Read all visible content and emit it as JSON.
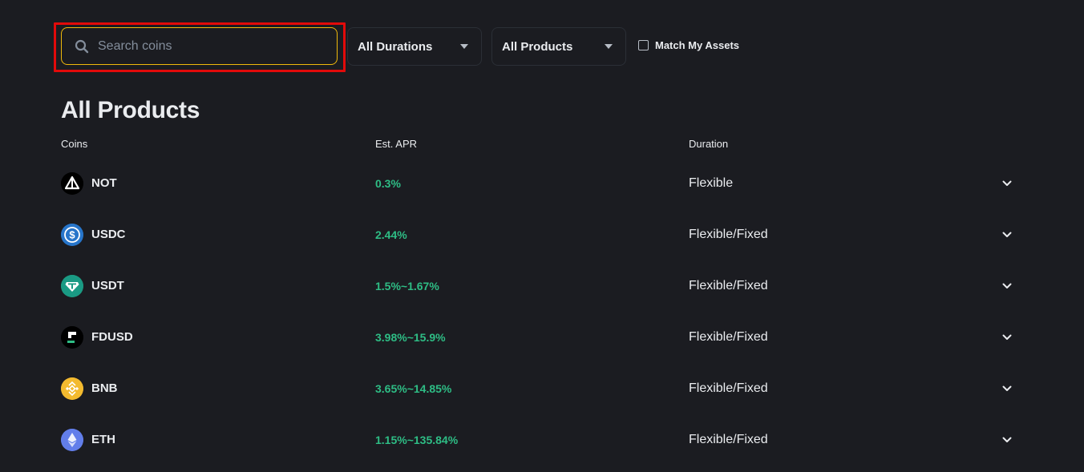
{
  "filters": {
    "search_placeholder": "Search coins",
    "search_value": "",
    "durations_label": "All Durations",
    "products_label": "All Products",
    "match_assets_label": "Match My Assets",
    "match_assets_checked": false
  },
  "title": "All Products",
  "columns": {
    "coins": "Coins",
    "apr": "Est. APR",
    "duration": "Duration"
  },
  "rows": [
    {
      "coin": "NOT",
      "apr": "0.3%",
      "duration": "Flexible",
      "icon": "notcoin-icon"
    },
    {
      "coin": "USDC",
      "apr": "2.44%",
      "duration": "Flexible/Fixed",
      "icon": "usdc-icon"
    },
    {
      "coin": "USDT",
      "apr": "1.5%~1.67%",
      "duration": "Flexible/Fixed",
      "icon": "usdt-icon"
    },
    {
      "coin": "FDUSD",
      "apr": "3.98%~15.9%",
      "duration": "Flexible/Fixed",
      "icon": "fdusd-icon"
    },
    {
      "coin": "BNB",
      "apr": "3.65%~14.85%",
      "duration": "Flexible/Fixed",
      "icon": "bnb-icon"
    },
    {
      "coin": "ETH",
      "apr": "1.15%~135.84%",
      "duration": "Flexible/Fixed",
      "icon": "eth-icon"
    }
  ],
  "colors": {
    "background": "#1b1c21",
    "accent": "#f0b90b",
    "positive": "#2ebd85",
    "highlight": "#e20a0a",
    "text": "#eaecef",
    "muted": "#848e9c"
  }
}
